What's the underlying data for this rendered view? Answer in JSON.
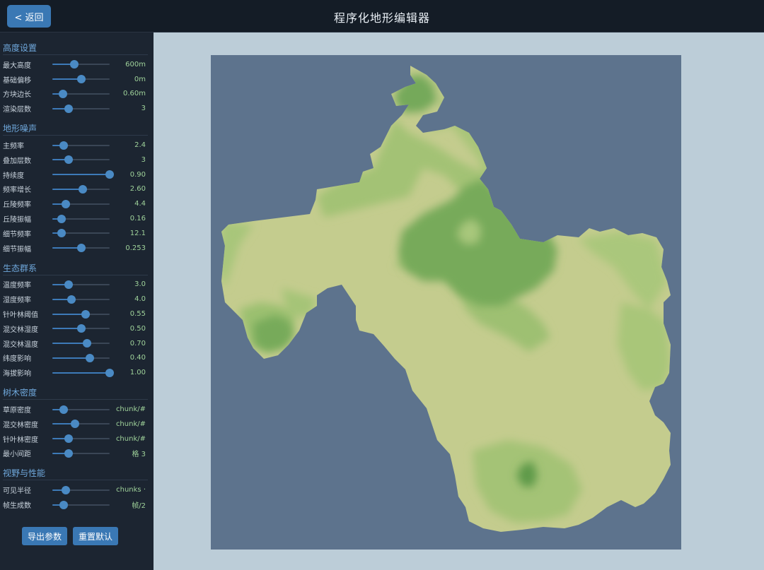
{
  "header": {
    "back_label": "< 返回",
    "title": "程序化地形编辑器"
  },
  "sections": [
    {
      "title": "高度设置",
      "rows": [
        {
          "label": "最大高度",
          "value": "600m",
          "level": 0.38
        },
        {
          "label": "基础偏移",
          "value": "0m",
          "level": 0.5
        },
        {
          "label": "方块边长",
          "value": "0.60m",
          "level": 0.18
        },
        {
          "label": "渲染层数",
          "value": "3",
          "level": 0.28
        }
      ]
    },
    {
      "title": "地形噪声",
      "rows": [
        {
          "label": "主频率",
          "value": "2.4",
          "level": 0.2
        },
        {
          "label": "叠加层数",
          "value": "3",
          "level": 0.28
        },
        {
          "label": "持续度",
          "value": "0.90",
          "level": 1.0
        },
        {
          "label": "频率增长",
          "value": "2.60",
          "level": 0.53
        },
        {
          "label": "丘陵频率",
          "value": "4.4",
          "level": 0.24
        },
        {
          "label": "丘陵振幅",
          "value": "0.16",
          "level": 0.16
        },
        {
          "label": "细节频率",
          "value": "12.1",
          "level": 0.16
        },
        {
          "label": "细节振幅",
          "value": "0.253",
          "level": 0.5
        }
      ]
    },
    {
      "title": "生态群系",
      "rows": [
        {
          "label": "温度频率",
          "value": "3.0",
          "level": 0.28
        },
        {
          "label": "湿度频率",
          "value": "4.0",
          "level": 0.33
        },
        {
          "label": "针叶林阈值",
          "value": "0.55",
          "level": 0.58
        },
        {
          "label": "混交林湿度",
          "value": "0.50",
          "level": 0.5
        },
        {
          "label": "混交林温度",
          "value": "0.70",
          "level": 0.6
        },
        {
          "label": "纬度影响",
          "value": "0.40",
          "level": 0.66
        },
        {
          "label": "海拔影响",
          "value": "1.00",
          "level": 1.0
        }
      ]
    },
    {
      "title": "树木密度",
      "rows": [
        {
          "label": "草原密度",
          "value": "#/chunk",
          "level": 0.2
        },
        {
          "label": "混交林密度",
          "value": "#/chunk",
          "level": 0.4
        },
        {
          "label": "针叶林密度",
          "value": "#/chunk",
          "level": 0.29
        },
        {
          "label": "最小间距",
          "value": "3 格",
          "level": 0.28
        }
      ]
    },
    {
      "title": "视野与性能",
      "rows": [
        {
          "label": "可见半径",
          "value": "· chunks",
          "level": 0.23
        },
        {
          "label": "帧生成数",
          "value": "2/帧",
          "level": 0.2
        }
      ]
    }
  ],
  "actions": {
    "export_label": "导出参数",
    "reset_label": "重置默认"
  },
  "colors": {
    "water": "#5d738d",
    "land_light": "#c4cc8e",
    "land_mid": "#9fc173",
    "land_dark": "#74a85a",
    "land_darkest": "#5e9a48",
    "accent": "#3a78b4",
    "value_text": "#9fd29a"
  }
}
